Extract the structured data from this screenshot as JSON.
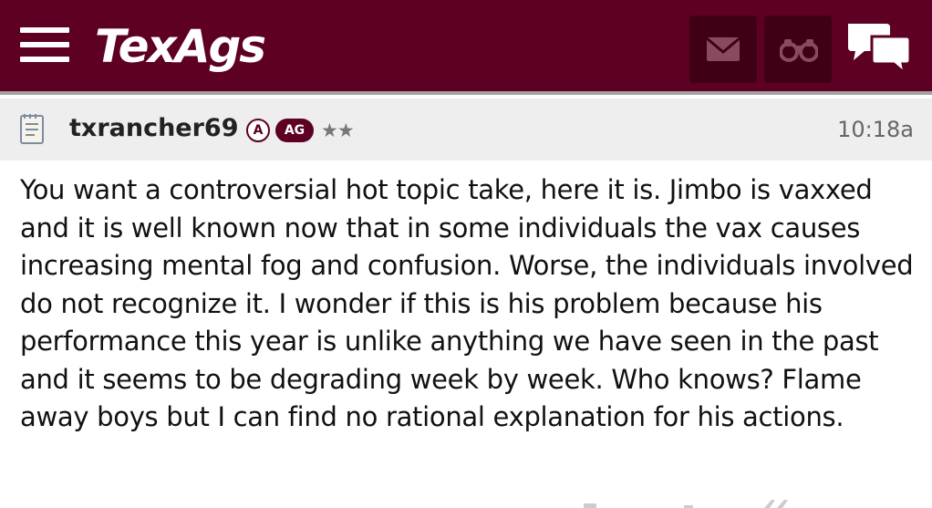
{
  "header": {
    "logo_text": "TexAgs",
    "menu_icon": "hamburger-menu-icon",
    "mail_icon": "mail-icon",
    "binoculars_icon": "binoculars-icon",
    "chat_icon": "chat-bubbles-icon",
    "brand_color": "#5e0024"
  },
  "post": {
    "icon": "notepad-icon",
    "username": "txrancher69",
    "badge_a": "A",
    "badge_ag": "AG",
    "stars": "★★",
    "timestamp": "10:18a",
    "body": "You want a controversial hot topic take, here it is. Jimbo is vaxxed and it is well known now that in some individuals the vax causes increasing mental fog and confusion. Worse, the individuals involved do not recognize it. I wonder if this is his problem because his performance this year is unlike anything we have seen in the past and it seems to be degrading week by week. Who knows? Flame away boys but I can find no rational explanation for his actions."
  }
}
